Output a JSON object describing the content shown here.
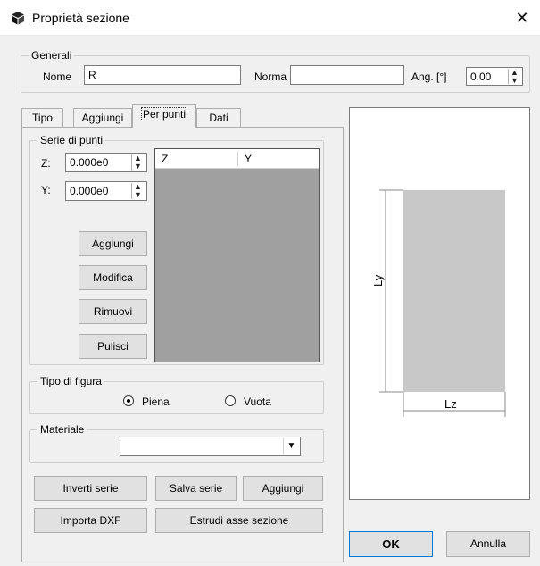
{
  "window": {
    "title": "Proprietà sezione",
    "close_glyph": "✕"
  },
  "generali": {
    "legend": "Generali",
    "nome_label": "Nome",
    "nome_value": "R",
    "norma_label": "Norma",
    "norma_value": "",
    "ang_label": "Ang. [°]",
    "ang_value": "0.00"
  },
  "tabs": [
    "Tipo",
    "Aggiungi",
    "Per punti",
    "Dati"
  ],
  "active_tab": "Per punti",
  "serie": {
    "legend": "Serie di punti",
    "z_label": "Z:",
    "z_value": "0.000e0",
    "y_label": "Y:",
    "y_value": "0.000e0",
    "columns": [
      "Z",
      "Y"
    ],
    "buttons": {
      "aggiungi": "Aggiungi",
      "modifica": "Modifica",
      "rimuovi": "Rimuovi",
      "pulisci": "Pulisci"
    }
  },
  "tipo_figura": {
    "legend": "Tipo di figura",
    "piena": "Piena",
    "vuota": "Vuota",
    "selected": "Piena"
  },
  "materiale": {
    "legend": "Materiale",
    "value": ""
  },
  "bottom_buttons": {
    "inverti": "Inverti serie",
    "salva": "Salva serie",
    "aggiungi": "Aggiungi",
    "importa": "Importa DXF",
    "estrudi": "Estrudi asse sezione"
  },
  "preview": {
    "ly_label": "Ly",
    "lz_label": "Lz",
    "fill_color": "#c8c8c8"
  },
  "footer": {
    "ok": "OK",
    "annulla": "Annulla"
  }
}
